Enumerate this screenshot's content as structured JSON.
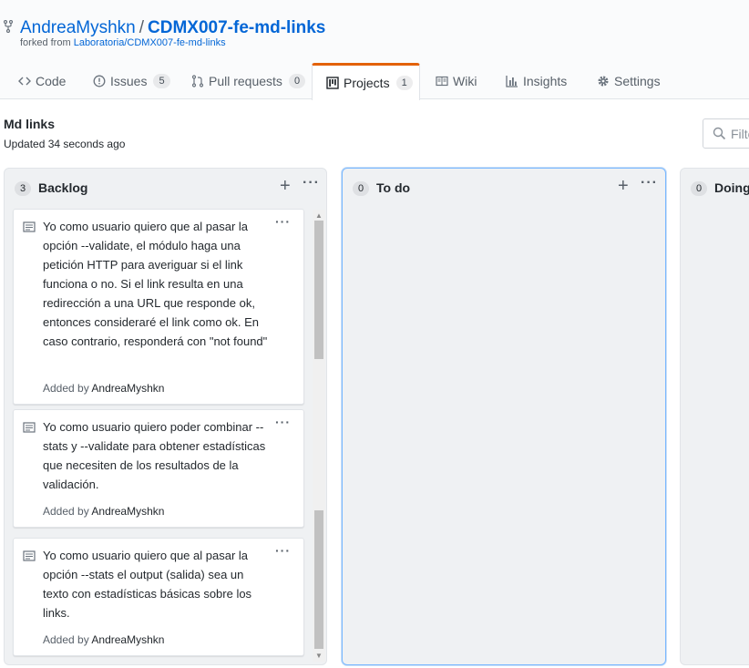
{
  "repo": {
    "owner": "AndreaMyshkn",
    "separator": "/",
    "name": "CDMX007-fe-md-links",
    "forked_prefix": "forked from",
    "forked_from": "Laboratoria/CDMX007-fe-md-links"
  },
  "tabs": [
    {
      "label": "Code",
      "icon": "code-icon"
    },
    {
      "label": "Issues",
      "count": "5",
      "icon": "issue-icon"
    },
    {
      "label": "Pull requests",
      "count": "0",
      "icon": "pull-request-icon"
    },
    {
      "label": "Projects",
      "count": "1",
      "icon": "project-icon",
      "selected": true
    },
    {
      "label": "Wiki",
      "icon": "book-icon"
    },
    {
      "label": "Insights",
      "icon": "graph-icon"
    },
    {
      "label": "Settings",
      "icon": "gear-icon"
    }
  ],
  "project": {
    "title": "Md links",
    "updated": "Updated 34 seconds ago",
    "filter_placeholder": "Filte"
  },
  "columns": [
    {
      "count": "3",
      "name": "Backlog",
      "cards": [
        {
          "text": "Yo como usuario quiero que al pasar la opción --validate, el módulo haga una petición HTTP para averiguar si el link funciona o no. Si el link resulta en una redirección a una URL que responde ok, entonces consideraré el link como ok. En caso contrario, responderá con \"not found\"",
          "added_prefix": "Added by",
          "author": "AndreaMyshkn"
        },
        {
          "text": "Yo como usuario quiero poder combinar --stats y --validate para obtener estadísticas que necesiten de los resultados de la validación.",
          "added_prefix": "Added by",
          "author": "AndreaMyshkn"
        },
        {
          "text": "Yo como usuario quiero que al pasar la opción --stats el output (salida) sea un texto con estadísticas básicas sobre los links.",
          "added_prefix": "Added by",
          "author": "AndreaMyshkn"
        }
      ]
    },
    {
      "count": "0",
      "name": "To do",
      "cards": []
    },
    {
      "count": "0",
      "name": "Doing",
      "cards": []
    }
  ],
  "colors": {
    "link": "#0366d6",
    "tab_accent": "#e36209",
    "column_bg": "#eff1f3",
    "focus_border": "#79b8ff"
  }
}
